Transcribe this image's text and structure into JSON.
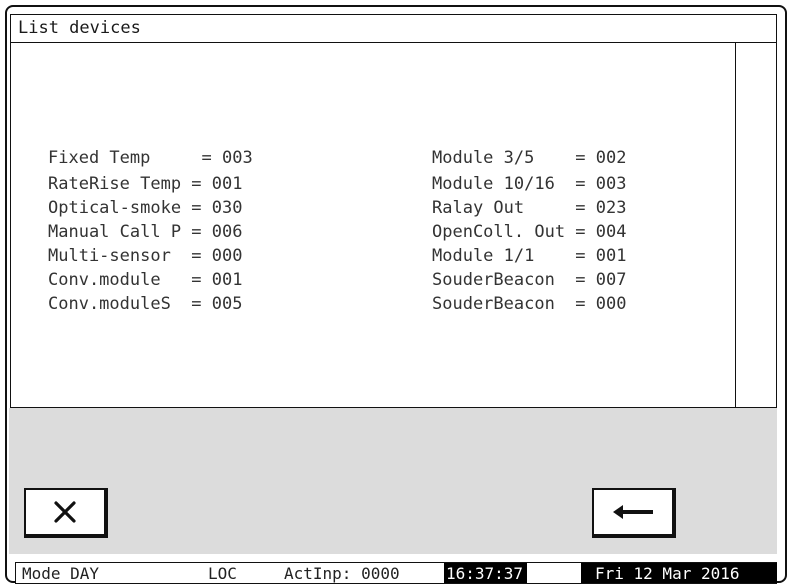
{
  "window": {
    "title": "List devices"
  },
  "devices_left": [
    {
      "text": "Fixed Temp     = 003"
    },
    {
      "text": "RateRise Temp = 001"
    },
    {
      "text": "Optical-smoke = 030"
    },
    {
      "text": "Manual Call P = 006"
    },
    {
      "text": "Multi-sensor  = 000"
    },
    {
      "text": "Conv.module   = 001"
    },
    {
      "text": "Conv.moduleS  = 005"
    }
  ],
  "devices_right": [
    {
      "text": "Module 3/5    = 002"
    },
    {
      "text": "Module 10/16  = 003"
    },
    {
      "text": "Ralay Out     = 023"
    },
    {
      "text": "OpenColl. Out = 004"
    },
    {
      "text": "Module 1/1    = 001"
    },
    {
      "text": "SouderBeacon  = 007"
    },
    {
      "text": "SouderBeacon  = 000"
    }
  ],
  "buttons": {
    "close_icon": "close-x-icon",
    "back_icon": "arrow-left-icon"
  },
  "status": {
    "mode": "Mode DAY",
    "loc": "LOC",
    "actinp": "ActInp: 0000",
    "time": "16:37:37",
    "date": "Fri 12 Mar 2016"
  }
}
